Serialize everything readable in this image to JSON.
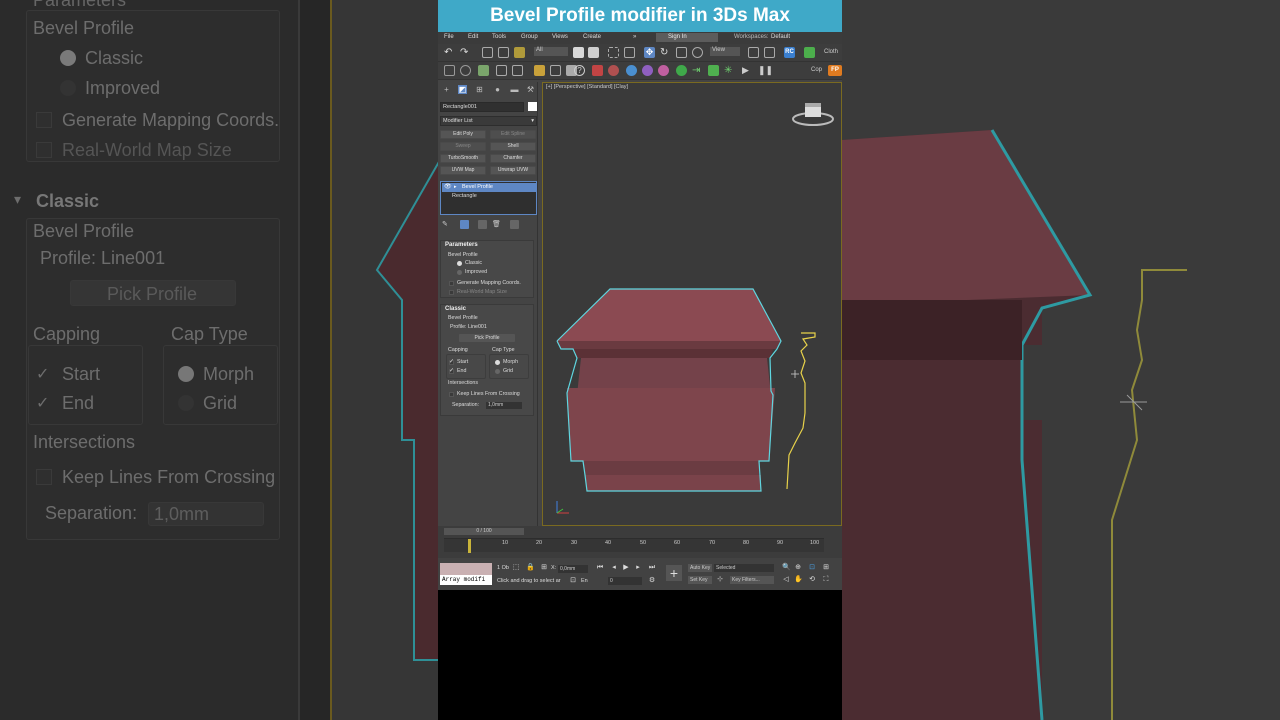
{
  "video_title": "Bevel Profile modifier in 3Ds Max",
  "menu": {
    "items": [
      "File",
      "Edit",
      "Tools",
      "Group",
      "Views",
      "Create",
      "»"
    ],
    "sign_in": "Sign In",
    "workspaces_label": "Workspaces:",
    "workspaces_value": "Default"
  },
  "toolbar": {
    "selection_filter": "All",
    "view_dropdown": "View",
    "rc_label": "RC",
    "cloth_label": "Cloth",
    "cop_label": "Cop",
    "fp_label": "FP"
  },
  "command_panel": {
    "object_name": "Rectangle001",
    "modifier_list": "Modifier List",
    "modifier_buttons": [
      {
        "label": "Edit Poly",
        "enabled": true
      },
      {
        "label": "Edit Spline",
        "enabled": false
      },
      {
        "label": "Sweep",
        "enabled": false
      },
      {
        "label": "Shell",
        "enabled": true
      },
      {
        "label": "TurboSmooth",
        "enabled": true
      },
      {
        "label": "Chamfer",
        "enabled": true
      },
      {
        "label": "UVW Map",
        "enabled": true
      },
      {
        "label": "Unwrap UVW",
        "enabled": true
      }
    ],
    "stack": [
      "Bevel Profile",
      "Rectangle"
    ],
    "parameters": {
      "title": "Parameters",
      "bevel_profile_label": "Bevel Profile",
      "classic": "Classic",
      "improved": "Improved",
      "generate_mapping": "Generate Mapping Coords.",
      "real_world": "Real-World Map Size"
    },
    "classic": {
      "title": "Classic",
      "bevel_profile_label": "Bevel Profile",
      "profile_label": "Profile: Line001",
      "pick_profile": "Pick Profile",
      "capping": "Capping",
      "cap_type": "Cap Type",
      "start": "Start",
      "end": "End",
      "morph": "Morph",
      "grid": "Grid",
      "intersections": "Intersections",
      "keep_lines": "Keep Lines From Crossing",
      "separation_label": "Separation:",
      "separation_value": "1,0mm"
    }
  },
  "viewport": {
    "label": "[+] [Perspective] [Standard] [Clay]"
  },
  "timeline": {
    "slider": "0 / 100",
    "ticks": [
      "10",
      "20",
      "30",
      "40",
      "50",
      "60",
      "70",
      "80",
      "90",
      "100"
    ]
  },
  "statusbar": {
    "script_text": "Array modifi",
    "selected_count": "1 Ob",
    "prompt": "Click and drag to select ar",
    "x_label": "X:",
    "x_value": "0,0mm",
    "en_label": "En",
    "frame_value": "0",
    "auto_key": "Auto Key",
    "auto_key_value": "Selected",
    "set_key": "Set Key",
    "key_filters": "Key Filters..."
  },
  "background_left": {
    "parameters_header": "Parameters",
    "bevel_profile": "Bevel Profile",
    "classic_radio": "Classic",
    "improved_radio": "Improved",
    "generate_mapping": "Generate Mapping Coords.",
    "real_world": "Real-World Map Size",
    "classic_header": "Classic",
    "bevel_profile_2": "Bevel Profile",
    "profile": "Profile: Line001",
    "pick_profile": "Pick Profile",
    "capping": "Capping",
    "cap_type": "Cap Type",
    "start": "Start",
    "end": "End",
    "morph": "Morph",
    "grid": "Grid",
    "intersections": "Intersections",
    "keep_lines": "Keep Lines From Crossing",
    "separation": "Separation:",
    "separation_value": "1,0mm"
  },
  "colors": {
    "title_bar": "#3fa9c8",
    "selection_outline": "#5fd6e0",
    "object_fill": "#8b4a52",
    "profile_line": "#e8d24a",
    "stack_selected": "#5e87c4"
  }
}
